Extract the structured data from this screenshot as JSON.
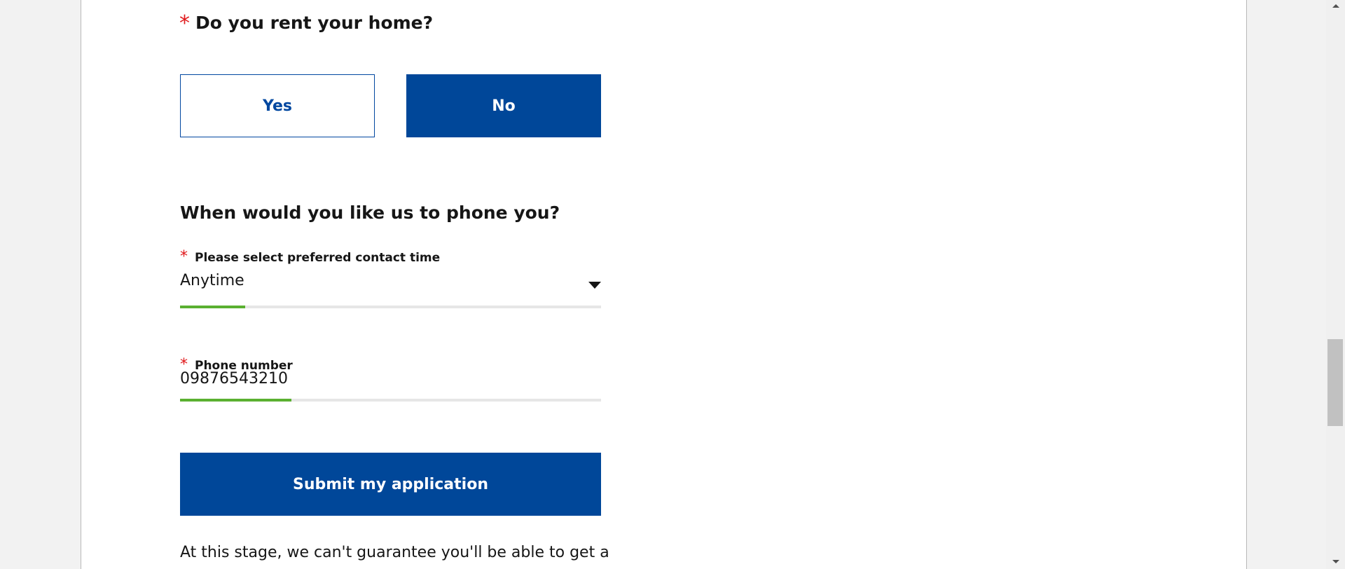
{
  "rent_question": {
    "required_marker": "*",
    "text": "Do you rent your home?"
  },
  "rent_options": {
    "yes_label": "Yes",
    "no_label": "No",
    "selected": "No"
  },
  "contact_section": {
    "heading": "When would you like us to phone you?"
  },
  "contact_time": {
    "required_marker": "*",
    "label": "Please select preferred contact time",
    "value": "Anytime",
    "progress_fraction": 0.155
  },
  "phone": {
    "required_marker": "*",
    "label": "Phone number",
    "value": "09876543210",
    "progress_fraction": 0.265
  },
  "submit_label": "Submit my application",
  "disclaimer": "At this stage, we can't guarantee you'll be able to get a",
  "scrollbar": {
    "position_fraction": 0.6
  },
  "colors": {
    "brand_blue": "#004799",
    "required_red": "#e0181b",
    "progress_green": "#5ab031"
  }
}
